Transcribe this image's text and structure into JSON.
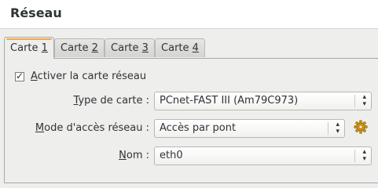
{
  "header": {
    "title": "Réseau"
  },
  "tabs": [
    {
      "prefix": "Carte ",
      "accel": "1",
      "active": true
    },
    {
      "prefix": "Carte ",
      "accel": "2",
      "active": false
    },
    {
      "prefix": "Carte ",
      "accel": "3",
      "active": false
    },
    {
      "prefix": "Carte ",
      "accel": "4",
      "active": false
    }
  ],
  "enable": {
    "accel": "A",
    "rest": "ctiver la carte réseau",
    "checked": true
  },
  "adapter_type": {
    "accel": "T",
    "rest": "ype de carte :",
    "value": "PCnet-FAST III (Am79C973)"
  },
  "access_mode": {
    "accel": "M",
    "rest": "ode d'accès réseau :",
    "value": "Accès par pont"
  },
  "name": {
    "accel": "N",
    "rest": "om :",
    "value": "eth0"
  },
  "icons": {
    "checkmark": "checkmark-icon",
    "combo_arrow": "up-down-arrows-icon",
    "settings": "gear-icon"
  },
  "colors": {
    "accent": "#f3a648",
    "gear": "#d99b0e"
  }
}
